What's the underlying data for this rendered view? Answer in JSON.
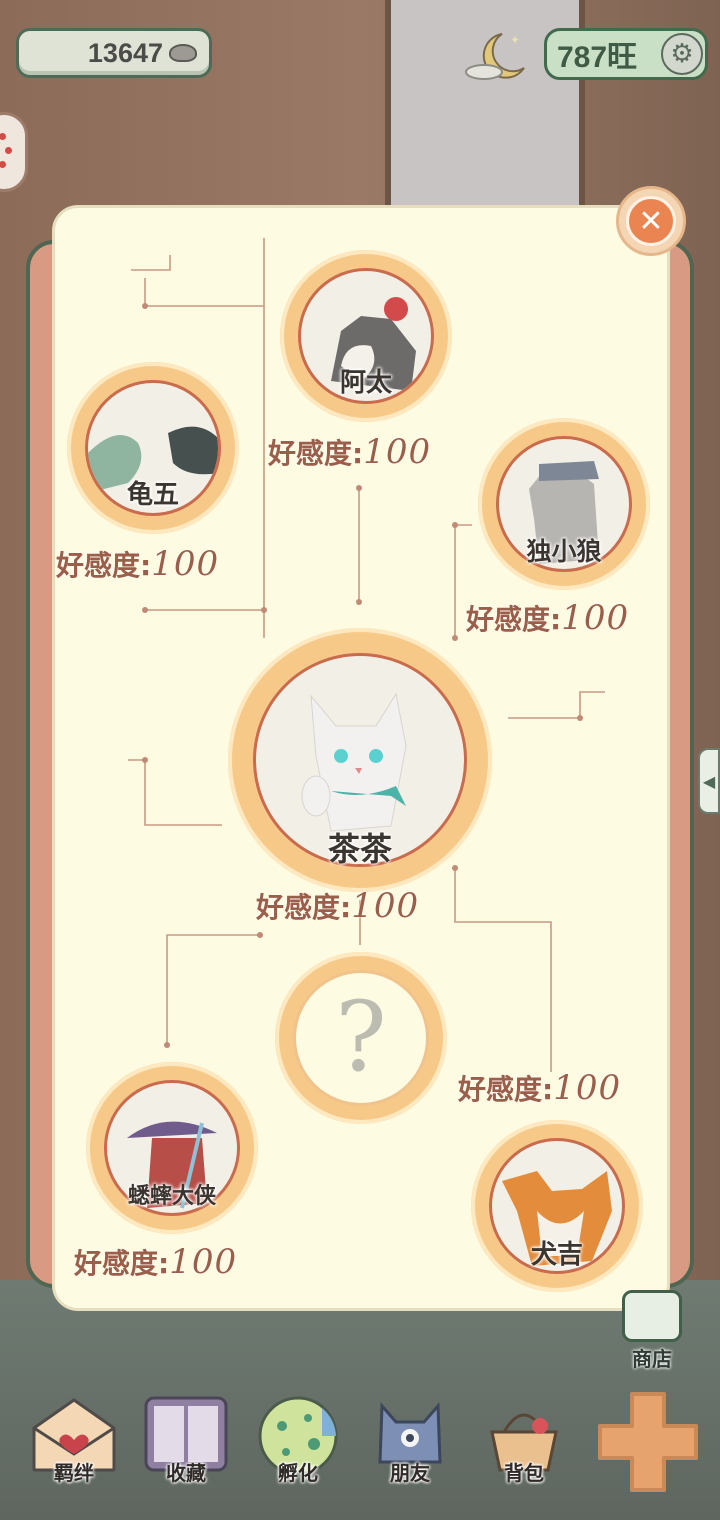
{
  "top_bar": {
    "coins": "13647",
    "currency": "787旺",
    "coin_icon": "ingot-icon",
    "night_icon": "moon-icon",
    "settings_icon": "gear-icon"
  },
  "dialog": {
    "close_icon": "close-icon",
    "center": {
      "name": "茶茶",
      "affinity_label": "好感度:",
      "affinity_value": "100"
    },
    "characters": [
      {
        "name": "阿太",
        "affinity_label": "好感度:",
        "affinity_value": "100"
      },
      {
        "name": "龟五",
        "affinity_label": "好感度:",
        "affinity_value": "100"
      },
      {
        "name": "独小狼",
        "affinity_label": "好感度:",
        "affinity_value": "100"
      },
      {
        "name": "蟋蟀大侠",
        "affinity_label": "好感度:",
        "affinity_value": "100"
      },
      {
        "name": "犬吉",
        "affinity_label": "好感度:",
        "affinity_value": "100"
      }
    ],
    "unknown": {
      "mark": "?"
    }
  },
  "bottom_nav": [
    {
      "label": "羁绊",
      "icon": "heart-letter-icon"
    },
    {
      "label": "收藏",
      "icon": "album-icon"
    },
    {
      "label": "孵化",
      "icon": "egg-icon"
    },
    {
      "label": "朋友",
      "icon": "cat-face-icon"
    },
    {
      "label": "背包",
      "icon": "basket-icon"
    }
  ],
  "shop": {
    "label": "商店",
    "icon": "shop-icon"
  },
  "colors": {
    "dialog_bg": "#fdfbe2",
    "ring": "#f7c989",
    "affinity_text": "#9a5e4a",
    "accent_green": "#4f6b58"
  }
}
